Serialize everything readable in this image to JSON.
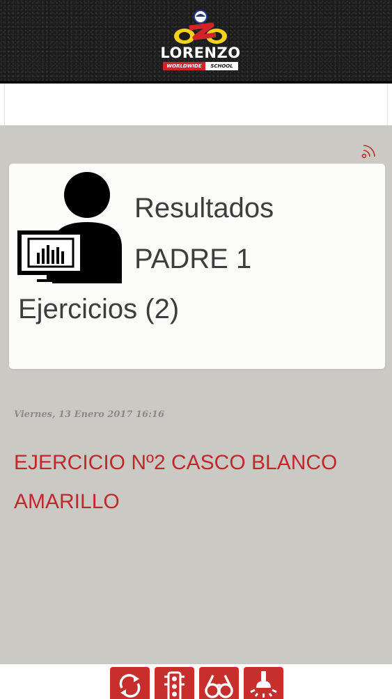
{
  "header": {
    "logo_text": "LORENZO",
    "logo_sub_left": "WORLDWIDE",
    "logo_sub_right": "SCHOOL"
  },
  "card": {
    "title": "Resultados",
    "subtitle": "PADRE 1",
    "count_label": "Ejercicios (2)",
    "icon": "user-chart-icon"
  },
  "feed": {
    "timestamp": "Viernes, 13 Enero 2017 16:16",
    "exercise_title": "EJERCICIO Nº2 CASCO BLANCO AMARILLO"
  },
  "toolbar": {
    "buttons": [
      {
        "icon": "refresh-icon"
      },
      {
        "icon": "traffic-light-icon"
      },
      {
        "icon": "binoculars-icon"
      },
      {
        "icon": "light-bulb-icon"
      }
    ]
  },
  "colors": {
    "accent": "#c62f2c",
    "content_bg": "#cbc9c4",
    "card_bg": "#fbfbfa",
    "text_dark": "#3d3d3d",
    "header_bg": "#1c1c1c"
  }
}
